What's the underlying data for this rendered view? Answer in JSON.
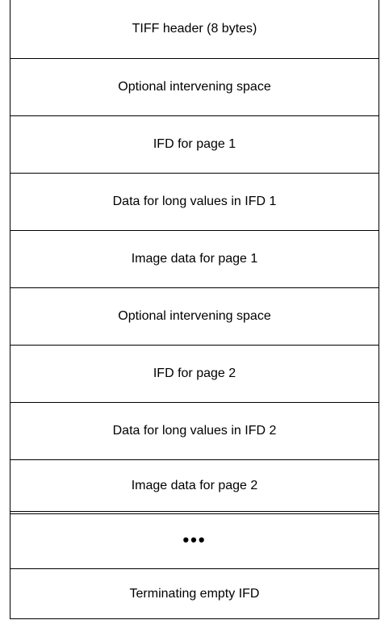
{
  "blocks": [
    {
      "label": "TIFF header (8 bytes)"
    },
    {
      "label": "Optional intervening space"
    },
    {
      "label": "IFD for page 1"
    },
    {
      "label": "Data for long values in IFD 1"
    },
    {
      "label": "Image data for page 1"
    },
    {
      "label": "Optional intervening space"
    },
    {
      "label": "IFD for page 2"
    },
    {
      "label": "Data for long values in IFD 2"
    },
    {
      "label": "Image data for page 2"
    },
    {
      "label": "•••"
    },
    {
      "label": "Terminating empty IFD"
    }
  ]
}
